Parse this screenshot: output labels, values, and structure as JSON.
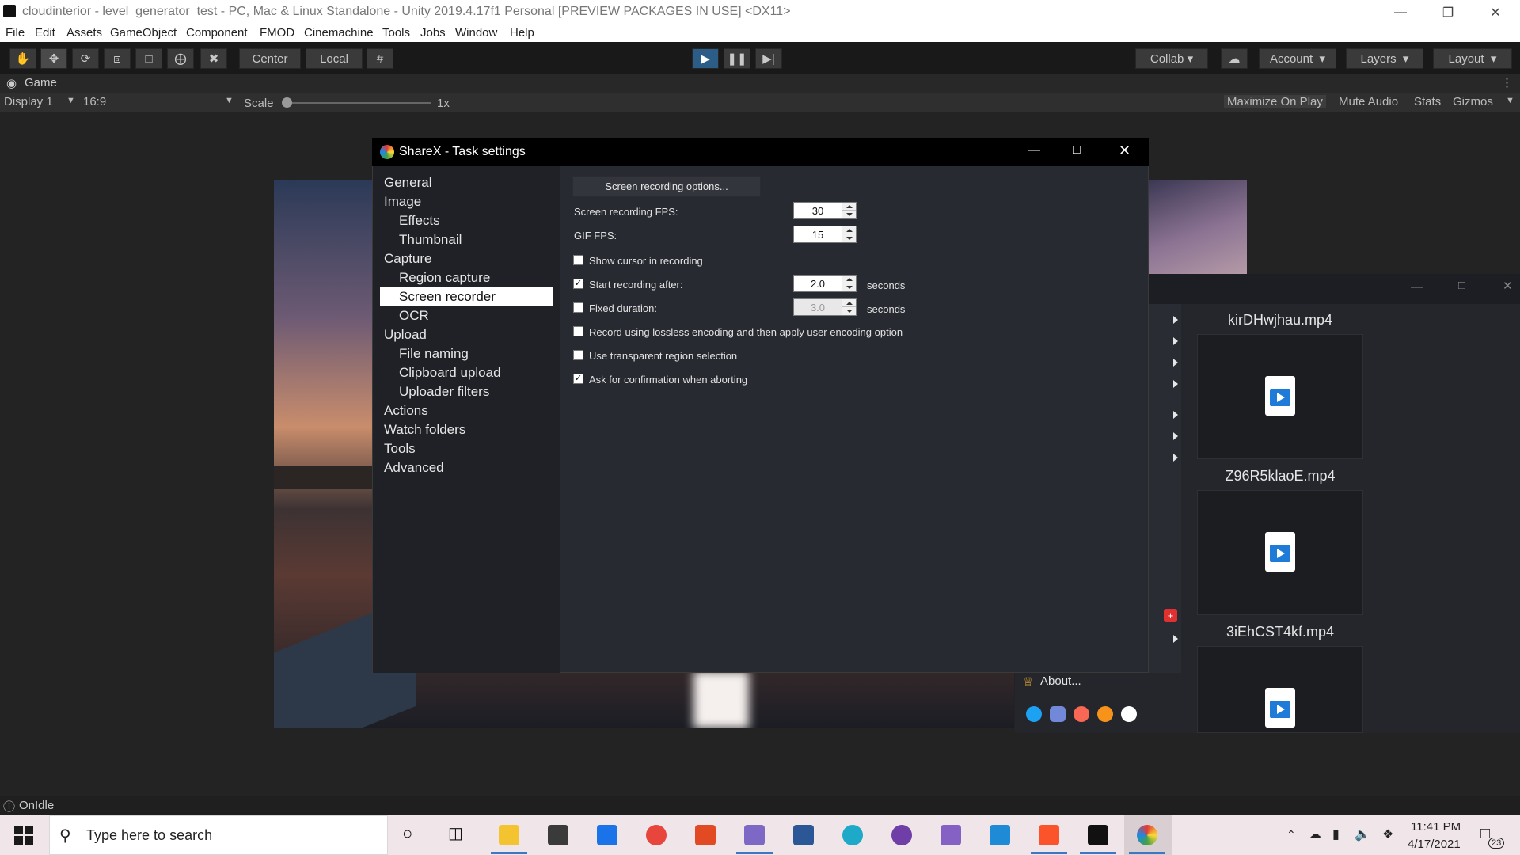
{
  "unity": {
    "title": "cloudinterior - level_generator_test - PC, Mac & Linux Standalone - Unity 2019.4.17f1 Personal [PREVIEW PACKAGES IN USE] <DX11>",
    "menu": [
      "File",
      "Edit",
      "Assets",
      "GameObject",
      "Component",
      "FMOD",
      "Cinemachine",
      "Tools",
      "Jobs",
      "Window",
      "Help"
    ],
    "toolbar": {
      "pivot_label": "Center",
      "space_label": "Local",
      "collab_label": "Collab",
      "account_label": "Account",
      "layers_label": "Layers",
      "layout_label": "Layout"
    },
    "game_tab": "Game",
    "game_controls": {
      "display": "Display 1",
      "aspect": "16:9",
      "scale_label": "Scale",
      "scale_value": "1x",
      "maximize": "Maximize On Play",
      "mute": "Mute Audio",
      "stats": "Stats",
      "gizmos": "Gizmos"
    },
    "status": "OnIdle"
  },
  "sharex_main": {
    "files": [
      "kirDHwjhau.mp4",
      "Z96R5klaoE.mp4",
      "3iEhCST4kf.mp4"
    ],
    "about_label": "About..."
  },
  "dialog": {
    "title": "ShareX - Task settings",
    "nav": [
      {
        "label": "General",
        "indent": 0
      },
      {
        "label": "Image",
        "indent": 0
      },
      {
        "label": "Effects",
        "indent": 1
      },
      {
        "label": "Thumbnail",
        "indent": 1
      },
      {
        "label": "Capture",
        "indent": 0
      },
      {
        "label": "Region capture",
        "indent": 1
      },
      {
        "label": "Screen recorder",
        "indent": 1,
        "selected": true
      },
      {
        "label": "OCR",
        "indent": 1
      },
      {
        "label": "Upload",
        "indent": 0
      },
      {
        "label": "File naming",
        "indent": 1
      },
      {
        "label": "Clipboard upload",
        "indent": 1
      },
      {
        "label": "Uploader filters",
        "indent": 1
      },
      {
        "label": "Actions",
        "indent": 0
      },
      {
        "label": "Watch folders",
        "indent": 0
      },
      {
        "label": "Tools",
        "indent": 0
      },
      {
        "label": "Advanced",
        "indent": 0
      }
    ],
    "options_button": "Screen recording options...",
    "fps_label": "Screen recording FPS:",
    "fps_value": "30",
    "gif_fps_label": "GIF FPS:",
    "gif_fps_value": "15",
    "show_cursor": {
      "label": "Show cursor in recording",
      "checked": false
    },
    "start_after": {
      "label": "Start recording after:",
      "checked": true,
      "value": "2.0",
      "unit": "seconds"
    },
    "fixed_duration": {
      "label": "Fixed duration:",
      "checked": false,
      "value": "3.0",
      "unit": "seconds"
    },
    "lossless": {
      "label": "Record using lossless encoding and then apply user encoding option",
      "checked": false
    },
    "transparent": {
      "label": "Use transparent region selection",
      "checked": false
    },
    "confirm_abort": {
      "label": "Ask for confirmation when aborting",
      "checked": true
    }
  },
  "taskbar": {
    "search_placeholder": "Type here to search",
    "time": "11:41 PM",
    "date": "4/17/2021",
    "notification_count": "23"
  },
  "colors": {
    "unity_play_active": "#2c5d87",
    "selection_bg": "#ffffff",
    "taskbar_bg": "#f0e6ea"
  }
}
